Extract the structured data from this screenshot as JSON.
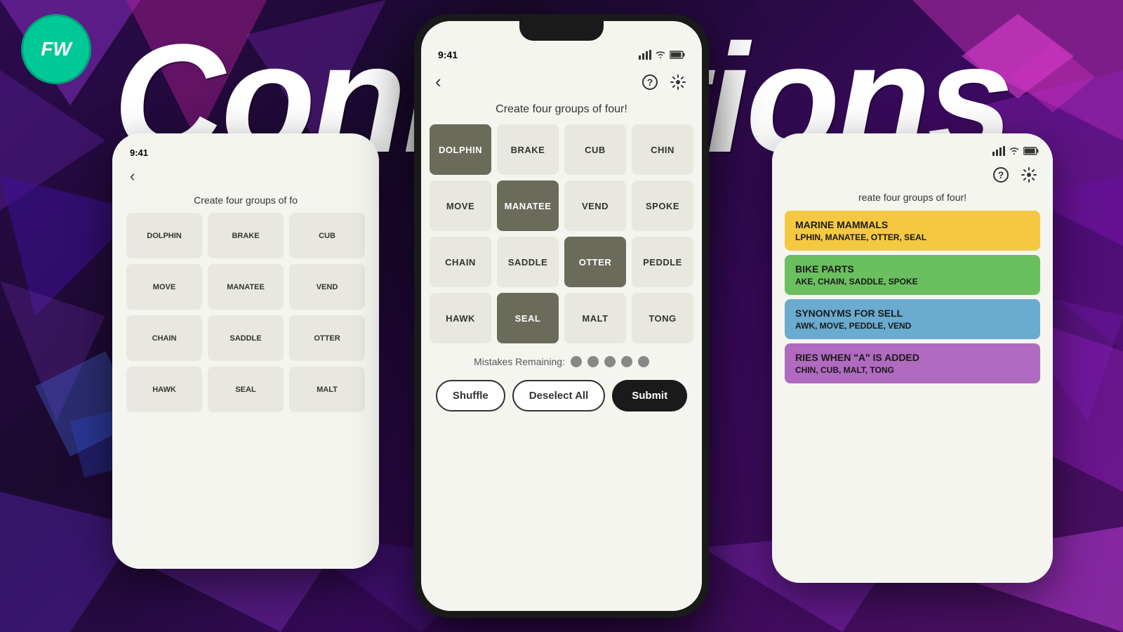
{
  "background": {
    "color": "#1a0a2e"
  },
  "logo": {
    "text": "FW"
  },
  "bigTitle": {
    "text": "Connections"
  },
  "centerPhone": {
    "statusBar": {
      "time": "9:41",
      "icons": "signal wifi battery"
    },
    "header": {
      "backArrow": "‹",
      "helpIcon": "?",
      "settingsIcon": "⚙"
    },
    "gameTitle": "Create four groups of four!",
    "grid": [
      {
        "word": "DOLPHIN",
        "selected": true
      },
      {
        "word": "BRAKE",
        "selected": false
      },
      {
        "word": "CUB",
        "selected": false
      },
      {
        "word": "CHIN",
        "selected": false
      },
      {
        "word": "MOVE",
        "selected": false
      },
      {
        "word": "MANATEE",
        "selected": true
      },
      {
        "word": "VEND",
        "selected": false
      },
      {
        "word": "SPOKE",
        "selected": false
      },
      {
        "word": "CHAIN",
        "selected": false
      },
      {
        "word": "SADDLE",
        "selected": false
      },
      {
        "word": "OTTER",
        "selected": true
      },
      {
        "word": "PEDDLE",
        "selected": false
      },
      {
        "word": "HAWK",
        "selected": false
      },
      {
        "word": "SEAL",
        "selected": true
      },
      {
        "word": "MALT",
        "selected": false
      },
      {
        "word": "TONG",
        "selected": false
      }
    ],
    "mistakes": {
      "label": "Mistakes Remaining:",
      "dots": 5
    },
    "buttons": {
      "shuffle": "Shuffle",
      "deselect": "Deselect All",
      "submit": "Submit"
    }
  },
  "leftPhone": {
    "statusBar": {
      "time": "9:41"
    },
    "header": {
      "backArrow": "‹"
    },
    "gameTitle": "Create four groups of fo",
    "grid": [
      {
        "word": "DOLPHIN"
      },
      {
        "word": "BRAKE"
      },
      {
        "word": "CUB"
      },
      {
        "word": "MOVE"
      },
      {
        "word": "MANATEE"
      },
      {
        "word": "VEND"
      },
      {
        "word": "CHAIN"
      },
      {
        "word": "SADDLE"
      },
      {
        "word": "OTTER"
      },
      {
        "word": "HAWK"
      },
      {
        "word": "SEAL"
      },
      {
        "word": "MALT"
      }
    ]
  },
  "rightPhone": {
    "statusBar": {
      "icons": "signal wifi battery"
    },
    "header": {
      "helpIcon": "?",
      "settingsIcon": "⚙"
    },
    "gameTitle": "reate four groups of four!",
    "groups": [
      {
        "color": "yellow",
        "title": "MARINE MAMMALS",
        "words": "LPHIN, MANATEE, OTTER, SEAL"
      },
      {
        "color": "green",
        "title": "BIKE PARTS",
        "words": "AKE, CHAIN, SADDLE, SPOKE"
      },
      {
        "color": "blue",
        "title": "SYNONYMS FOR SELL",
        "words": "AWK, MOVE, PEDDLE, VEND"
      },
      {
        "color": "purple",
        "title": "RIES WHEN \"A\" IS ADDED",
        "words": "CHIN, CUB, MALT, TONG"
      }
    ]
  }
}
